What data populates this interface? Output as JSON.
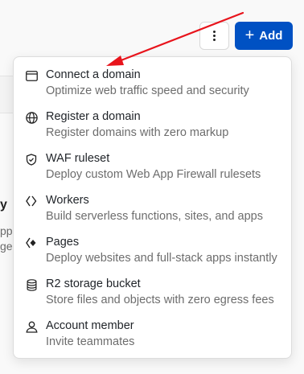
{
  "header": {
    "more_icon": "more-vertical-icon",
    "add_label": "Add",
    "add_icon": "plus-icon",
    "accent_color": "#0051c3"
  },
  "background": {
    "fragment_heading": "y",
    "fragment_line1": "pp",
    "fragment_line2": "ge"
  },
  "menu": {
    "items": [
      {
        "id": "connect-domain",
        "icon": "browser-window-icon",
        "title": "Connect a domain",
        "description": "Optimize web traffic speed and security"
      },
      {
        "id": "register-domain",
        "icon": "globe-icon",
        "title": "Register a domain",
        "description": "Register domains with zero markup"
      },
      {
        "id": "waf-ruleset",
        "icon": "shield-icon",
        "title": "WAF ruleset",
        "description": "Deploy custom Web App Firewall rulesets"
      },
      {
        "id": "workers",
        "icon": "workers-icon",
        "title": "Workers",
        "description": "Build serverless functions, sites, and apps"
      },
      {
        "id": "pages",
        "icon": "pages-icon",
        "title": "Pages",
        "description": "Deploy websites and full-stack apps instantly"
      },
      {
        "id": "r2-storage-bucket",
        "icon": "database-icon",
        "title": "R2 storage bucket",
        "description": "Store files and objects with zero egress fees"
      },
      {
        "id": "account-member",
        "icon": "user-icon",
        "title": "Account member",
        "description": "Invite teammates"
      }
    ]
  },
  "annotation": {
    "arrow_color": "#e8141c"
  }
}
